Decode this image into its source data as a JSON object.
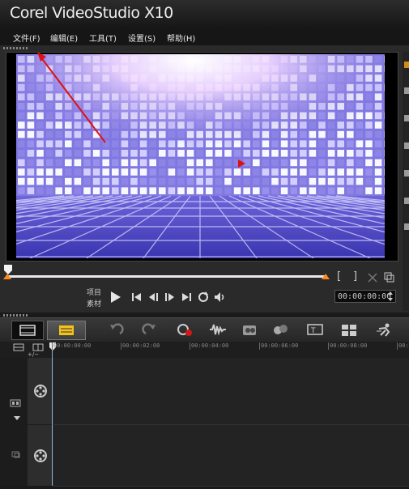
{
  "app": {
    "title": "Corel VideoStudio X10"
  },
  "menu": [
    "文件(F)",
    "编辑(E)",
    "工具(T)",
    "设置(S)",
    "帮助(H)"
  ],
  "player": {
    "mode_project": "项目",
    "mode_clip": "素材",
    "timecode": "00:00:00:00",
    "mark_in": "[",
    "mark_out": "]"
  },
  "ruler": {
    "ticks": [
      "00:00:00:00",
      "00:00:02:00",
      "00:00:04:00",
      "00:00:06:00",
      "00:00:08:00",
      "00:"
    ]
  },
  "colors": {
    "accent": "#ff8a1a",
    "annotation_arrow": "#e01010"
  },
  "icons": [
    "play-icon",
    "go-to-start-icon",
    "previous-frame-icon",
    "next-frame-icon",
    "go-to-end-icon",
    "repeat-icon",
    "volume-icon",
    "undo-icon",
    "redo-icon",
    "record-capture-icon",
    "sound-mixer-icon",
    "auto-music-icon",
    "motion-tracking-icon",
    "subtitle-editor-icon",
    "multi-camera-icon",
    "speed-icon",
    "film-reel-icon"
  ]
}
